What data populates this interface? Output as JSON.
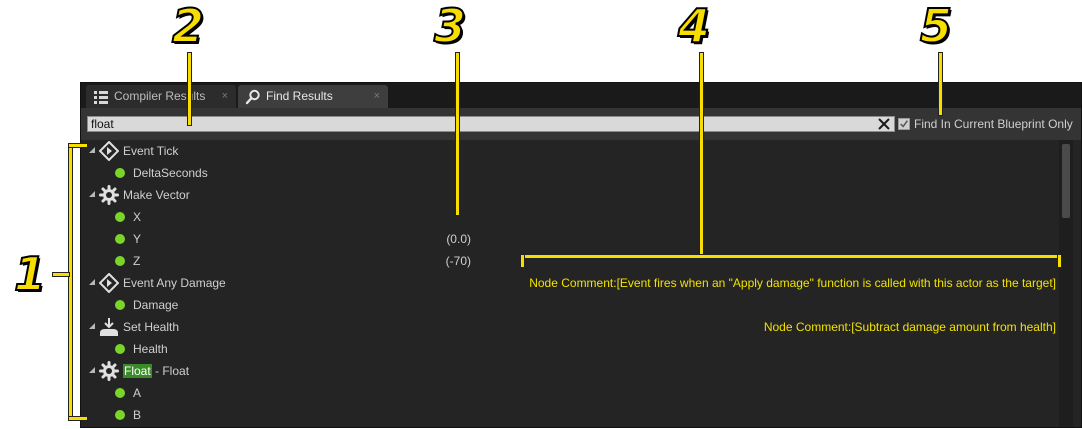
{
  "annotations": [
    "1",
    "2",
    "3",
    "4",
    "5"
  ],
  "tabs": [
    {
      "label": "Compiler Results",
      "icon": "list-icon",
      "close": "×"
    },
    {
      "label": "Find Results",
      "icon": "search-icon",
      "close": "×"
    }
  ],
  "search": {
    "value": "float",
    "clear_icon": "close-icon"
  },
  "filter": {
    "checked": true,
    "label": "Find In Current Blueprint Only"
  },
  "results": {
    "event_tick": {
      "label": "Event Tick",
      "icon": "event-icon"
    },
    "delta_seconds": {
      "label": "DeltaSeconds"
    },
    "make_vector": {
      "label": "Make Vector",
      "icon": "function-gear-icon"
    },
    "x": {
      "label": "X"
    },
    "y": {
      "label": "Y",
      "value": "(0.0)"
    },
    "z": {
      "label": "Z",
      "value": "(-70)"
    },
    "event_any_damage": {
      "label": "Event Any Damage",
      "icon": "event-icon",
      "comment": "Node Comment:[Event fires when an \"Apply damage\" function is called with this actor as the target]"
    },
    "damage": {
      "label": "Damage"
    },
    "set_health": {
      "label": "Set Health",
      "icon": "set-variable-icon",
      "comment": "Node Comment:[Subtract damage amount from health]"
    },
    "health": {
      "label": "Health"
    },
    "float_float": {
      "highlight": "Float",
      "rest": " - Float",
      "icon": "function-gear-icon"
    },
    "a": {
      "label": "A"
    },
    "b": {
      "label": "B"
    }
  },
  "colors": {
    "annotation": "#f7dd00",
    "pin": "#7bd42a",
    "comment": "#f2e200",
    "match_highlight": "#3a8a2a"
  }
}
